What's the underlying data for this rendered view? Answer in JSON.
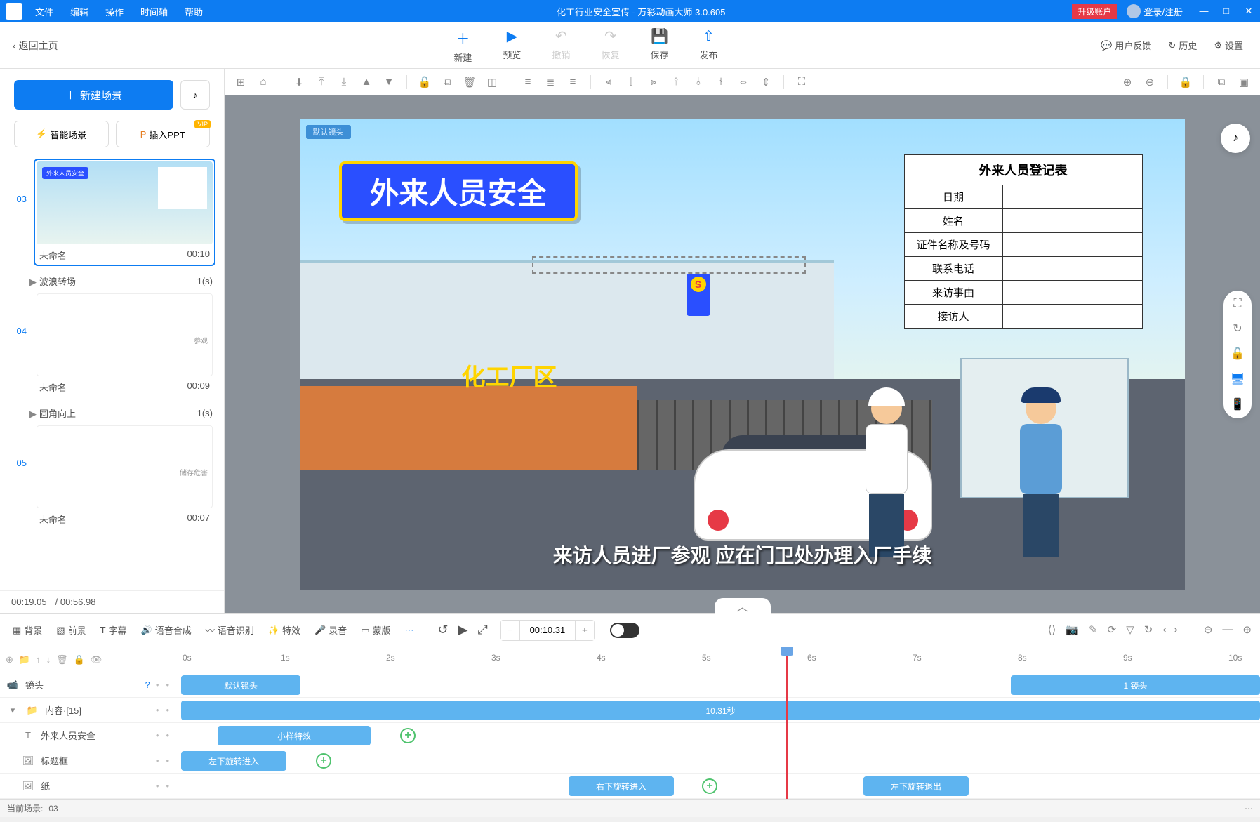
{
  "titlebar": {
    "menus": [
      "文件",
      "编辑",
      "操作",
      "时间轴",
      "帮助"
    ],
    "title": "化工行业安全宣传 - 万彩动画大师 3.0.605",
    "upgrade": "升级账户",
    "login": "登录/注册"
  },
  "toolbar": {
    "back": "返回主页",
    "buttons": [
      {
        "label": "新建",
        "icon": "＋",
        "disabled": false
      },
      {
        "label": "预览",
        "icon": "▶",
        "disabled": false
      },
      {
        "label": "撤销",
        "icon": "↶",
        "disabled": true
      },
      {
        "label": "恢复",
        "icon": "↷",
        "disabled": true
      },
      {
        "label": "保存",
        "icon": "💾",
        "disabled": false
      },
      {
        "label": "发布",
        "icon": "⇧",
        "disabled": false
      }
    ],
    "right": {
      "feedback": "用户反馈",
      "history": "历史",
      "settings": "设置"
    }
  },
  "left": {
    "new_scene": "新建场景",
    "smart_scene": "智能场景",
    "insert_ppt": "插入PPT",
    "vip": "VIP",
    "scenes": [
      {
        "num": "03",
        "name": "未命名",
        "time": "00:10",
        "active": true,
        "thumb_title": "外来人员安全",
        "transition_name": "波浪转场",
        "transition_time": "1(s)"
      },
      {
        "num": "04",
        "name": "未命名",
        "time": "00:09",
        "active": false,
        "thumb_text": "参观",
        "transition_name": "圆角向上",
        "transition_time": "1(s)"
      },
      {
        "num": "05",
        "name": "未命名",
        "time": "00:07",
        "active": false,
        "thumb_text": "储存危害"
      }
    ],
    "current_time": "00:19.05",
    "total_time": "/ 00:56.98"
  },
  "canvas": {
    "camera_label": "默认镜头",
    "main_title": "外来人员安全",
    "form_header": "外来人员登记表",
    "form_rows": [
      "日期",
      "姓名",
      "证件名称及号码",
      "联系电话",
      "来访事由",
      "接访人"
    ],
    "subtitle": "来访人员进厂参观 应在门卫处办理入厂手续",
    "factory_sign": "化工厂区"
  },
  "timeline": {
    "tools": {
      "bg": "背景",
      "fg": "前景",
      "subtitle": "字幕",
      "tts": "语音合成",
      "asr": "语音识别",
      "fx": "特效",
      "record": "录音",
      "mask": "蒙版"
    },
    "time_value": "00:10.31",
    "ruler": [
      "0s",
      "1s",
      "2s",
      "3s",
      "4s",
      "5s",
      "6s",
      "7s",
      "8s",
      "9s",
      "10s"
    ],
    "layers": {
      "camera": {
        "name": "镜头",
        "default_clip": "默认镜头",
        "clip1": "1 镜头"
      },
      "content": {
        "name": "内容·[15]",
        "duration": "10.31秒"
      },
      "text": {
        "name": "外来人员安全",
        "fx": "小样特效"
      },
      "titlebox": {
        "name": "标题框",
        "fx": "左下旋转进入"
      },
      "paper": {
        "name": "纸",
        "fx_in": "右下旋转进入",
        "fx_out": "左下旋转退出"
      }
    }
  },
  "statusbar": {
    "label": "当前场景:",
    "value": "03"
  }
}
